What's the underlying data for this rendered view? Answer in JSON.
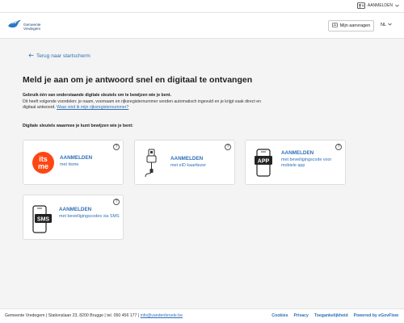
{
  "topbar": {
    "login_label": "AANMELDEN",
    "icon": "id-card-icon"
  },
  "header": {
    "logo": {
      "line1": "Gemeente",
      "line2": "Vredegem",
      "icon": "dove-icon"
    },
    "requests_button": "Mijn aanvragen",
    "language": "NL"
  },
  "main": {
    "back_link": "Terug naar startscherm",
    "title": "Meld je aan om je antwoord snel en digitaal te ontvangen",
    "intro_bold": "Gebruik één van onderstaande digitale sleutels om te bewijzen wie je bent.",
    "intro_text": "Dit heeft volgende voordelen: je naam, voornaam en rijksregisternummer worden automatisch ingevuld en je krijgt vaak direct en digitaal antwoord.",
    "intro_link": "Waar vind ik mijn rijksregisternummer?",
    "keys_label": "Digitale sleutels waarmee je kunt bewijzen wie je bent:",
    "cards": [
      {
        "title": "AANMELDEN",
        "subtitle": "met itsme",
        "icon": "itsme-logo-icon",
        "logo_text": "its me"
      },
      {
        "title": "AANMELDEN",
        "subtitle": "met eID kaartlezer",
        "icon": "card-reader-icon"
      },
      {
        "title": "AANMELDEN",
        "subtitle": "met beveiligingscode voor mobiele app",
        "icon": "mobile-app-icon",
        "badge": "APP"
      },
      {
        "title": "AANMELDEN",
        "subtitle": "met beveiligingscodes via SMS",
        "icon": "sms-phone-icon",
        "badge": "SMS"
      }
    ],
    "help_symbol": "?"
  },
  "footer": {
    "address": "Gemeente Vredegem | Stationslaan 23, 8200 Brugge | tel. 050 456 177 | ",
    "email": "info@vandenbroele.be",
    "links": [
      "Cookies",
      "Privacy",
      "Toegankelijkheid",
      "Powered by eGovFlow"
    ]
  },
  "colors": {
    "accent": "#2f6fb8",
    "itsme": "#ff4612",
    "background": "#f4f4f4"
  }
}
